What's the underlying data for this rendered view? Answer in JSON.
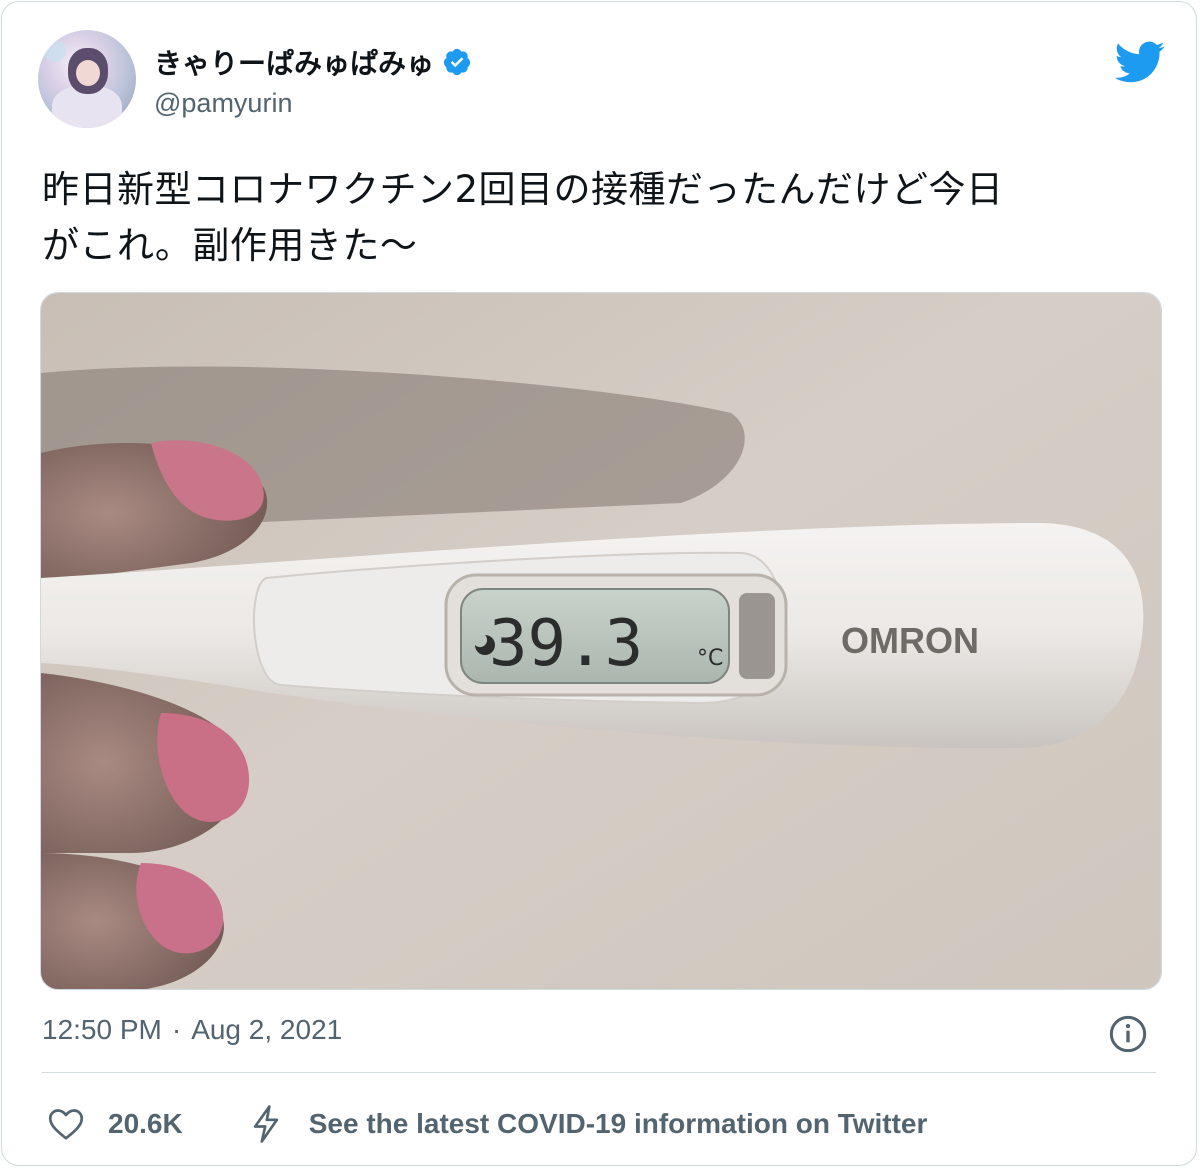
{
  "tweet": {
    "display_name": "きゃりーぱみゅぱみゅ",
    "handle": "@pamyurin",
    "text_line1": "昨日新型コロナワクチン2回目の接種だったんだけど今日",
    "text_line2": "がこれ。副作用きた〜",
    "time": "12:50 PM",
    "separator": "·",
    "date": "Aug 2, 2021",
    "like_count": "20.6K",
    "covid_notice": "See the latest COVID-19 information on Twitter"
  },
  "photo": {
    "thermometer_reading": "39.3",
    "unit": "°C",
    "brand": "OMRON"
  },
  "colors": {
    "twitter_blue": "#1d9bf0",
    "secondary_text": "#536471",
    "border": "#cfd9de"
  },
  "icons": [
    "twitter-bird-icon",
    "verified-badge-icon",
    "info-icon",
    "heart-icon",
    "bolt-icon"
  ]
}
